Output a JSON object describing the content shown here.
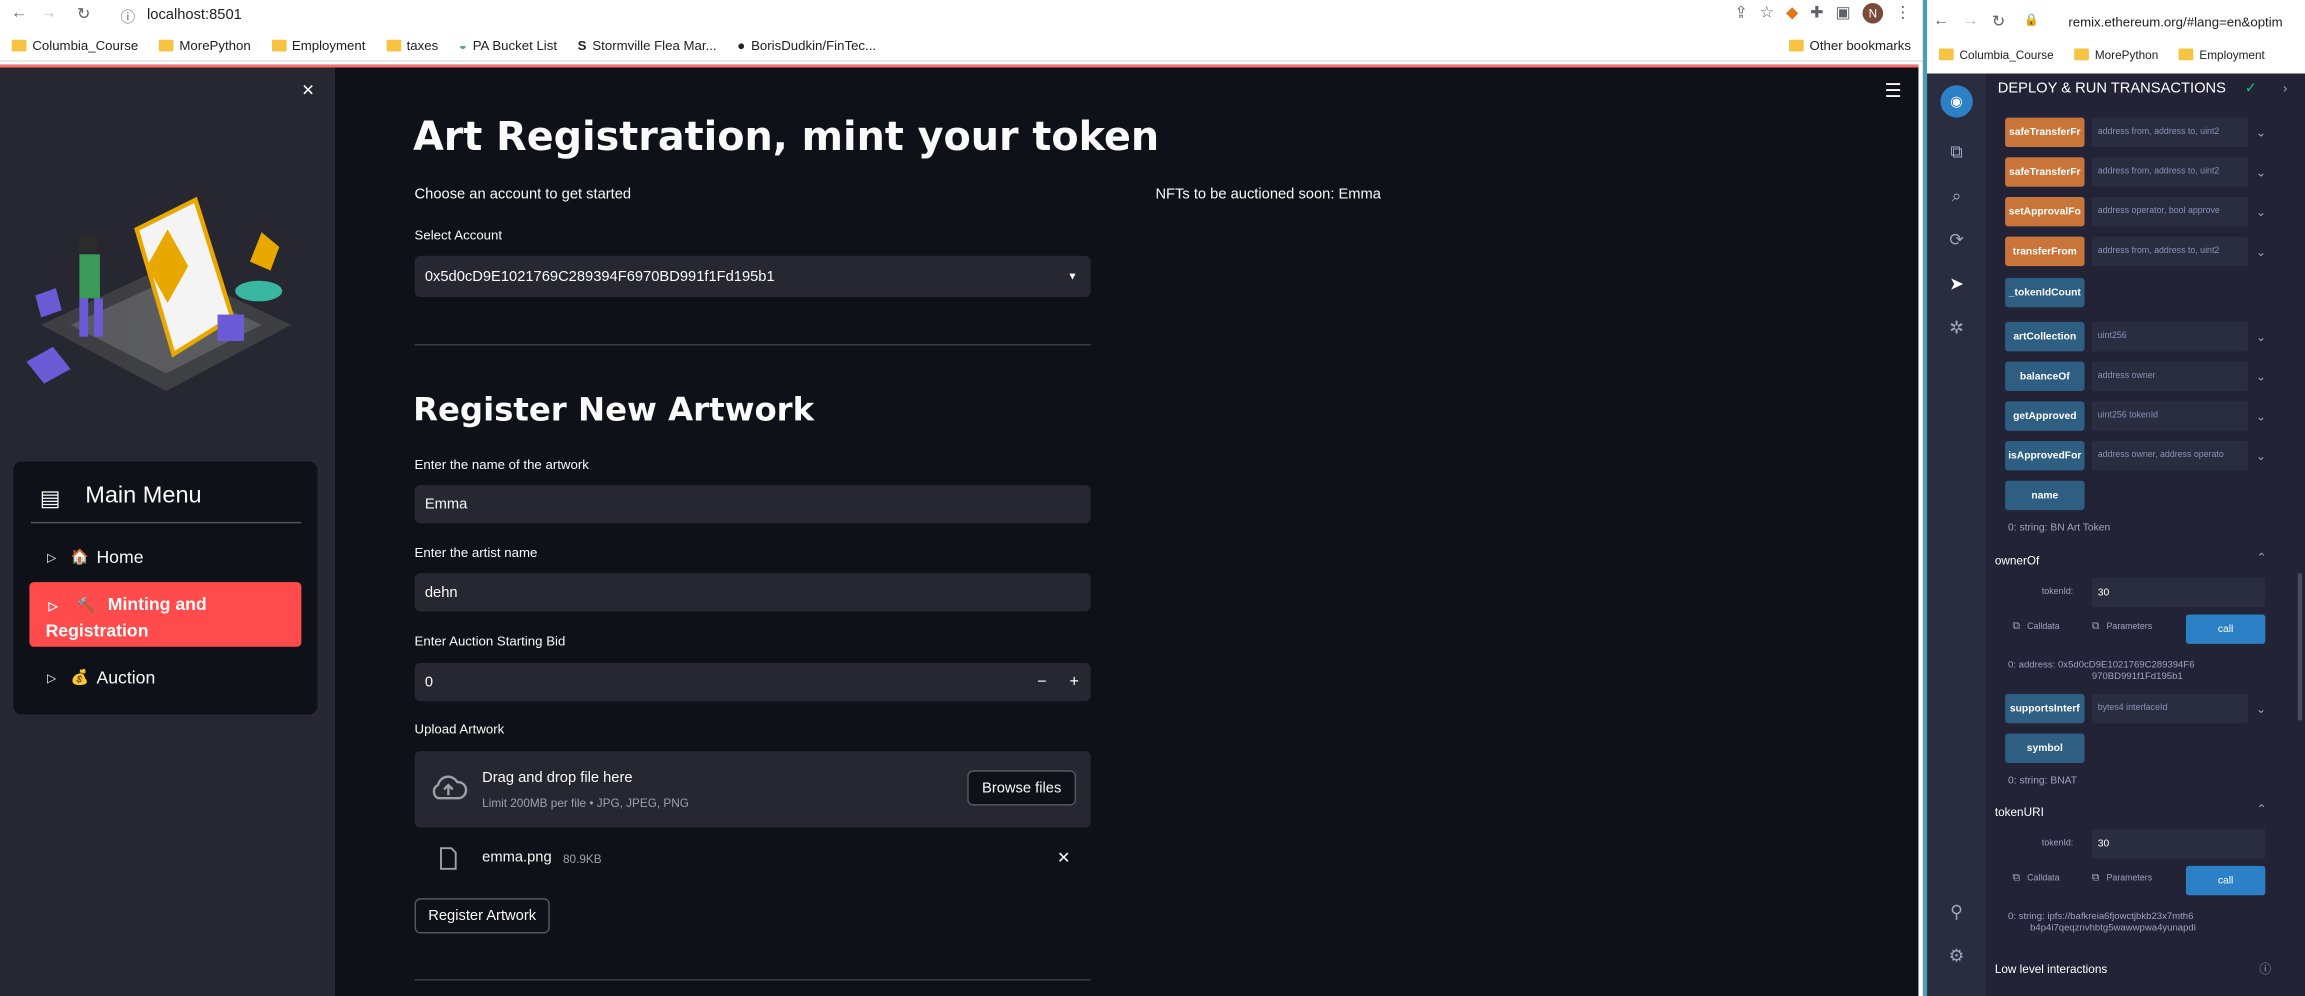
{
  "browser_left": {
    "url": "localhost:8501",
    "bookmarks": [
      "Columbia_Course",
      "MorePython",
      "Employment",
      "taxes",
      "PA Bucket List",
      "Stormville Flea Mar...",
      "BorisDudkin/FinTec..."
    ],
    "other_bookmarks": "Other bookmarks",
    "avatar_letter": "N"
  },
  "sidebar": {
    "close_glyph": "✕",
    "menu_title": "Main Menu",
    "items": [
      {
        "icon": "🏠",
        "label": "Home"
      },
      {
        "icon": "🔨",
        "label": "Minting and Registration"
      },
      {
        "icon": "💰",
        "label": "Auction"
      }
    ]
  },
  "main": {
    "hamburger_glyph": "☰",
    "title": "Art Registration, mint your token",
    "choose_text": "Choose an account to get started",
    "nfts_text": "NFTs to be auctioned soon: Emma",
    "select_label": "Select Account",
    "select_value": "0x5d0cD9E1021769C289394F6970BD991f1Fd195b1",
    "register_heading": "Register New Artwork",
    "artwork_name_label": "Enter the name of the artwork",
    "artwork_name_value": "Emma",
    "artist_label": "Enter the artist name",
    "artist_value": "dehn",
    "bid_label": "Enter Auction Starting Bid",
    "bid_value": "0",
    "bid_minus": "−",
    "bid_plus": "+",
    "upload_label": "Upload Artwork",
    "drop_title": "Drag and drop file here",
    "drop_sub": "Limit 200MB per file • JPG, JPEG, PNG",
    "browse_label": "Browse files",
    "file_name": "emma.png",
    "file_size": "80.9KB",
    "file_remove": "✕",
    "register_button": "Register Artwork"
  },
  "browser_right": {
    "url": "remix.ethereum.org/#lang=en&optim",
    "bookmarks": [
      "Columbia_Course",
      "MorePython",
      "Employment"
    ]
  },
  "remix": {
    "panel_title": "DEPLOY & RUN TRANSACTIONS",
    "functions": [
      {
        "name": "safeTransferFr",
        "hint": "address from, address to, uint2",
        "color": "orange",
        "chevron": true
      },
      {
        "name": "safeTransferFr",
        "hint": "address from, address to, uint2",
        "color": "orange",
        "chevron": true
      },
      {
        "name": "setApprovalFo",
        "hint": "address operator, bool approve",
        "color": "orange",
        "chevron": true
      },
      {
        "name": "transferFrom",
        "hint": "address from, address to, uint2",
        "color": "orange",
        "chevron": true
      },
      {
        "name": "_tokenIdCount",
        "hint": "",
        "color": "blue",
        "chevron": false
      },
      {
        "name": "artCollection",
        "hint": "uint256",
        "color": "blue",
        "chevron": true
      },
      {
        "name": "balanceOf",
        "hint": "address owner",
        "color": "blue",
        "chevron": true
      },
      {
        "name": "getApproved",
        "hint": "uint256 tokenId",
        "color": "blue",
        "chevron": true
      },
      {
        "name": "isApprovedFor",
        "hint": "address owner, address operato",
        "color": "blue",
        "chevron": true
      },
      {
        "name": "name",
        "hint": "",
        "color": "blue",
        "chevron": false
      }
    ],
    "name_result": "0: string: BN Art Token",
    "ownerOf": {
      "title": "ownerOf",
      "param_label": "tokenId:",
      "param_value": "30",
      "calldata": "Calldata",
      "parameters": "Parameters",
      "call": "call",
      "result_line1": "0: address: 0x5d0cD9E1021769C289394F6",
      "result_line2": "970BD991f1Fd195b1"
    },
    "supports": {
      "name": "supportsInterf",
      "hint": "bytes4 interfaceId"
    },
    "symbol": {
      "name": "symbol",
      "result": "0: string: BNAT"
    },
    "tokenURI": {
      "title": "tokenURI",
      "param_label": "tokenId:",
      "param_value": "30",
      "calldata": "Calldata",
      "parameters": "Parameters",
      "call": "call",
      "result_line1": "0: string: ipfs://bafkreia6fjowctjbkb23x7mth6",
      "result_line2": "b4p4i7qeqznvhbtg5wawwpwa4yunapdi"
    },
    "low_level": "Low level interactions"
  },
  "colors": {
    "accent": "#ff4b4b",
    "remix_orange": "#c97539",
    "remix_blue": "#2e5e82",
    "call_blue": "#2c80c5"
  }
}
